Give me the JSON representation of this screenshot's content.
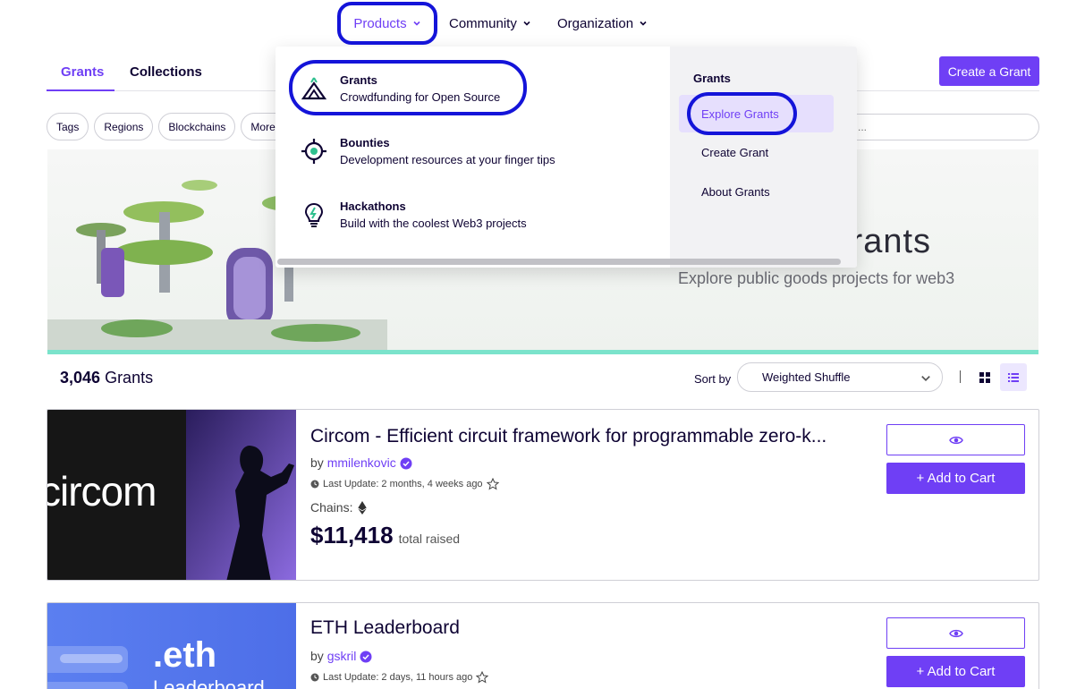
{
  "nav": {
    "products": "Products",
    "community": "Community",
    "organization": "Organization"
  },
  "tabs": {
    "grants": "Grants",
    "collections": "Collections"
  },
  "create_grant": "Create a Grant",
  "filters": [
    "Tags",
    "Regions",
    "Blockchains",
    "More Filters"
  ],
  "search_text": "...",
  "banner": {
    "title": "Grants",
    "subtitle": "Explore public goods projects for web3"
  },
  "dropdown": {
    "items": [
      {
        "title": "Grants",
        "desc": "Crowdfunding for Open Source",
        "icon": "grants-icon"
      },
      {
        "title": "Bounties",
        "desc": "Development resources at your finger tips",
        "icon": "bounties-icon"
      },
      {
        "title": "Hackathons",
        "desc": "Build with the coolest Web3 projects",
        "icon": "hackathons-icon"
      }
    ],
    "right_heading": "Grants",
    "right_links": [
      "Explore Grants",
      "Create Grant",
      "About Grants"
    ]
  },
  "results": {
    "count": "3,046",
    "count_label": "Grants",
    "sort_label": "Sort by",
    "sort_value": "Weighted Shuffle"
  },
  "cards": [
    {
      "title": "Circom - Efficient circuit framework for programmable zero-k...",
      "by": "by",
      "user": "mmilenkovic",
      "updated": "Last Update: 2 months, 4 weeks ago",
      "chains_label": "Chains:",
      "raised": "$11,418",
      "raised_label": "total raised",
      "thumb_text": "circom",
      "cart_label": "+ Add to Cart"
    },
    {
      "title": "ETH Leaderboard",
      "by": "by",
      "user": "gskril",
      "updated": "Last Update: 2 days, 11 hours ago",
      "thumb_text": ".eth",
      "thumb_text2": "Leaderboard",
      "cart_label": "+ Add to Cart"
    }
  ],
  "colors": {
    "accent": "#6f3ff5",
    "highlight_ring": "#1414d9",
    "banner_stripe": "#7be3cb"
  }
}
